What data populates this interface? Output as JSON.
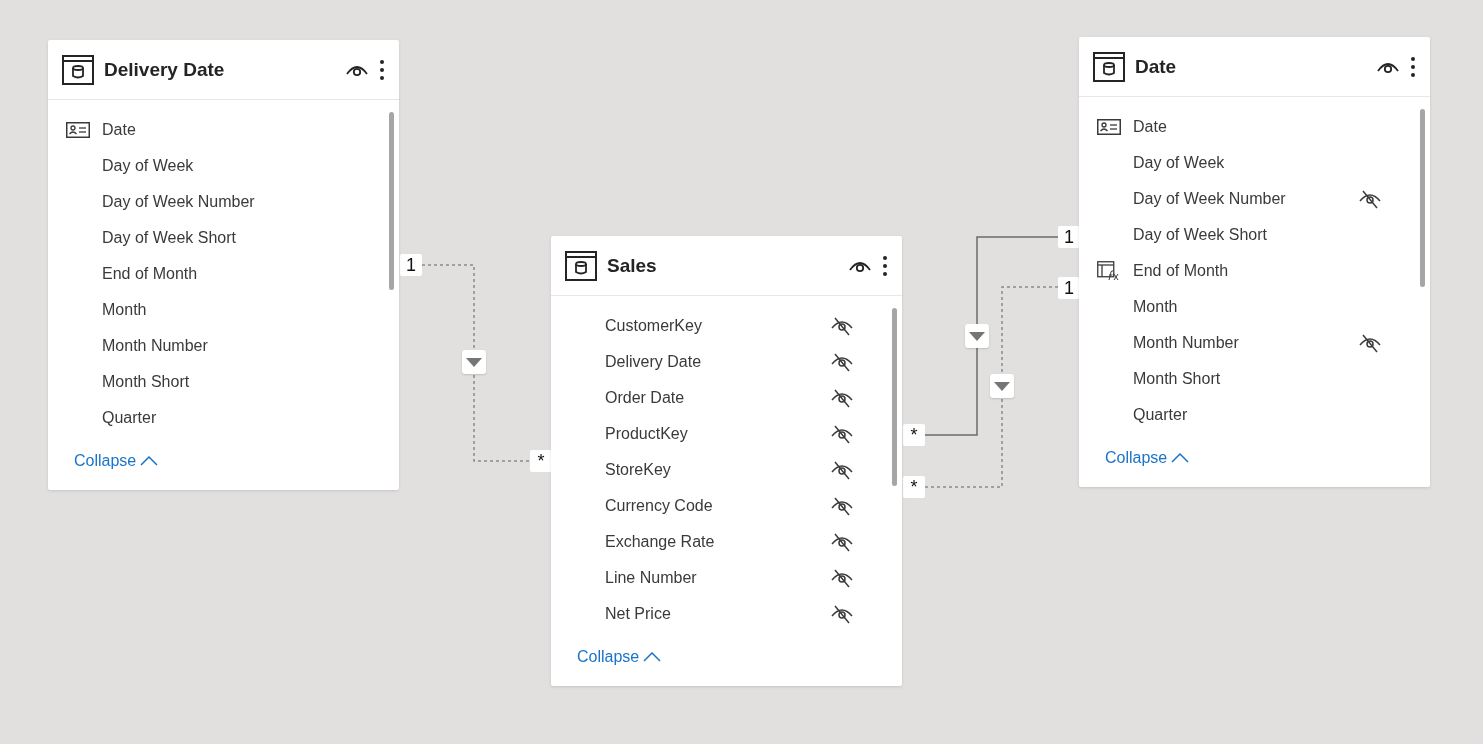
{
  "tables": [
    {
      "title": "Delivery Date",
      "fields": [
        {
          "name": "Date",
          "kind": "key",
          "hidden": false
        },
        {
          "name": "Day of Week",
          "kind": "plain",
          "hidden": false
        },
        {
          "name": "Day of Week Number",
          "kind": "plain",
          "hidden": false
        },
        {
          "name": "Day of Week Short",
          "kind": "plain",
          "hidden": false
        },
        {
          "name": "End of Month",
          "kind": "plain",
          "hidden": false
        },
        {
          "name": "Month",
          "kind": "plain",
          "hidden": false
        },
        {
          "name": "Month Number",
          "kind": "plain",
          "hidden": false
        },
        {
          "name": "Month Short",
          "kind": "plain",
          "hidden": false
        },
        {
          "name": "Quarter",
          "kind": "plain",
          "hidden": false
        }
      ],
      "collapse": "Collapse"
    },
    {
      "title": "Sales",
      "fields": [
        {
          "name": "CustomerKey",
          "kind": "plain",
          "hidden": true
        },
        {
          "name": "Delivery Date",
          "kind": "plain",
          "hidden": true
        },
        {
          "name": "Order Date",
          "kind": "plain",
          "hidden": true
        },
        {
          "name": "ProductKey",
          "kind": "plain",
          "hidden": true
        },
        {
          "name": "StoreKey",
          "kind": "plain",
          "hidden": true
        },
        {
          "name": "Currency Code",
          "kind": "plain",
          "hidden": true
        },
        {
          "name": "Exchange Rate",
          "kind": "plain",
          "hidden": true
        },
        {
          "name": "Line Number",
          "kind": "plain",
          "hidden": true
        },
        {
          "name": "Net Price",
          "kind": "plain",
          "hidden": true
        }
      ],
      "collapse": "Collapse"
    },
    {
      "title": "Date",
      "fields": [
        {
          "name": "Date",
          "kind": "key",
          "hidden": false
        },
        {
          "name": "Day of Week",
          "kind": "plain",
          "hidden": false
        },
        {
          "name": "Day of Week Number",
          "kind": "plain",
          "hidden": true
        },
        {
          "name": "Day of Week Short",
          "kind": "plain",
          "hidden": false
        },
        {
          "name": "End of Month",
          "kind": "calculated",
          "hidden": false
        },
        {
          "name": "Month",
          "kind": "plain",
          "hidden": false
        },
        {
          "name": "Month Number",
          "kind": "plain",
          "hidden": true
        },
        {
          "name": "Month Short",
          "kind": "plain",
          "hidden": false
        },
        {
          "name": "Quarter",
          "kind": "plain",
          "hidden": false
        }
      ],
      "collapse": "Collapse"
    }
  ],
  "relationships": [
    {
      "one_end": "1",
      "many_end": "*",
      "active": false
    },
    {
      "one_end": "1",
      "many_end": "*",
      "active": true
    },
    {
      "one_end": "1",
      "many_end": "*",
      "active": false
    }
  ]
}
